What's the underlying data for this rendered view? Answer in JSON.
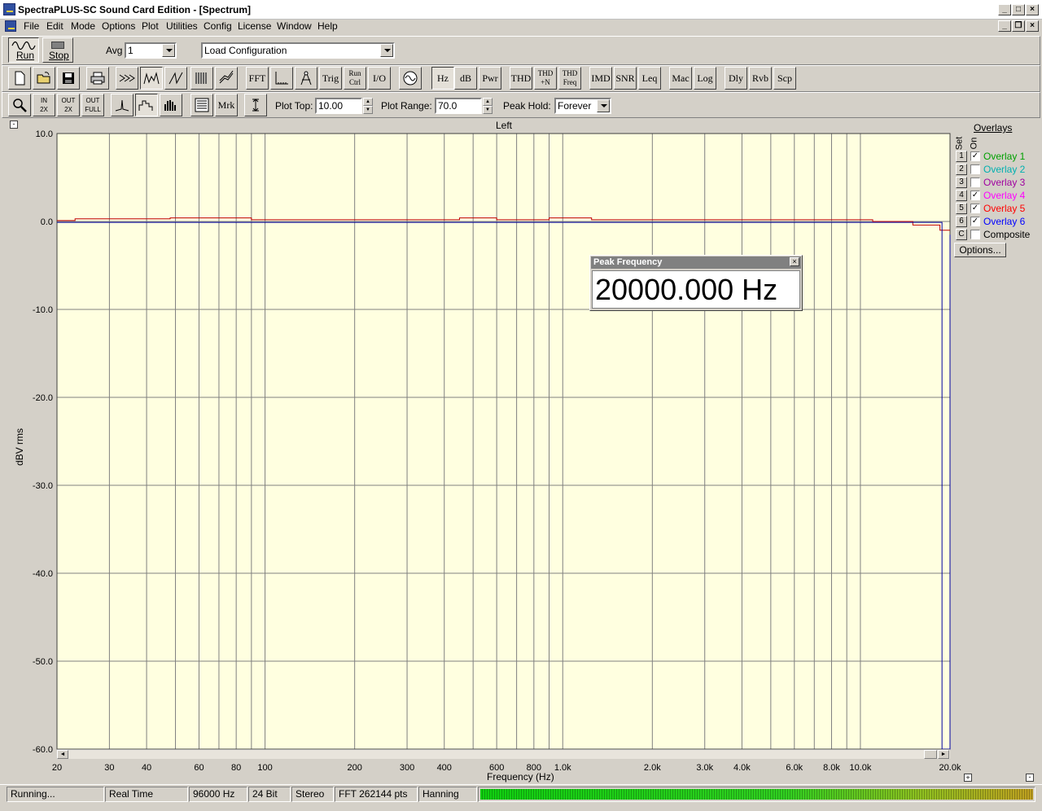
{
  "window": {
    "title": "SpectraPLUS-SC Sound Card Edition - [Spectrum]"
  },
  "menu": [
    "File",
    "Edit",
    "Mode",
    "Options",
    "Plot",
    "Utilities",
    "Config",
    "License",
    "Window",
    "Help"
  ],
  "toolbar1": {
    "run_label": "Run",
    "stop_label": "Stop",
    "avg_label": "Avg",
    "avg_value": "1",
    "config_value": "Load Configuration"
  },
  "toolbar2": {
    "fft": "FFT",
    "trig": "Trig",
    "run_ctrl_1": "Run",
    "run_ctrl_2": "Ctrl",
    "io": "I/O",
    "hz": "Hz",
    "db": "dB",
    "pwr": "Pwr",
    "thd": "THD",
    "thdn_1": "THD",
    "thdn_2": "+N",
    "thdf_1": "THD",
    "thdf_2": "Freq",
    "imd": "IMD",
    "snr": "SNR",
    "leq": "Leq",
    "mac": "Mac",
    "log": "Log",
    "dly": "Dly",
    "rvb": "Rvb",
    "scp": "Scp"
  },
  "toolbar3": {
    "zin_1": "IN",
    "zin_2": "2X",
    "zout_1": "OUT",
    "zout_2": "2X",
    "zfull_1": "OUT",
    "zfull_2": "FULL",
    "mrk": "Mrk",
    "plot_top_label": "Plot Top:",
    "plot_top_value": "10.00",
    "plot_range_label": "Plot Range:",
    "plot_range_value": "70.0",
    "peak_hold_label": "Peak Hold:",
    "peak_hold_value": "Forever"
  },
  "plot": {
    "channel_title": "Left",
    "ylabel": "dBV rms",
    "xlabel": "Frequency (Hz)",
    "y_ticks": [
      "10.0",
      "0.0",
      "-10.0",
      "-20.0",
      "-30.0",
      "-40.0",
      "-50.0",
      "-60.0"
    ],
    "x_ticks": [
      "20",
      "30",
      "40",
      "60",
      "80",
      "100",
      "200",
      "300",
      "400",
      "600",
      "800",
      "1.0k",
      "2.0k",
      "3.0k",
      "4.0k",
      "6.0k",
      "8.0k",
      "10.0k",
      "20.0k"
    ]
  },
  "overlays": {
    "title": "Overlays",
    "set_label": "Set",
    "on_label": "On",
    "items": [
      {
        "key": "1",
        "label": "Overlay 1",
        "checked": true,
        "color": "#00a000"
      },
      {
        "key": "2",
        "label": "Overlay 2",
        "checked": false,
        "color": "#00b0b0"
      },
      {
        "key": "3",
        "label": "Overlay 3",
        "checked": false,
        "color": "#a000a0"
      },
      {
        "key": "4",
        "label": "Overlay 4",
        "checked": true,
        "color": "#ff00ff"
      },
      {
        "key": "5",
        "label": "Overlay 5",
        "checked": true,
        "color": "#ff0000"
      },
      {
        "key": "6",
        "label": "Overlay 6",
        "checked": true,
        "color": "#0000ff"
      },
      {
        "key": "C",
        "label": "Composite",
        "checked": false,
        "color": "#000000"
      }
    ],
    "options_label": "Options..."
  },
  "peak_window": {
    "title": "Peak Frequency",
    "value": "20000.000 Hz"
  },
  "status": {
    "state": "Running...",
    "mode": "Real Time",
    "rate": "96000 Hz",
    "bits": "24 Bit",
    "channels": "Stereo",
    "fft": "FFT 262144 pts",
    "window": "Hanning"
  },
  "chart_data": {
    "type": "line",
    "title": "Left",
    "xlabel": "Frequency (Hz)",
    "ylabel": "dBV rms",
    "xscale": "log",
    "xlim": [
      20,
      20000
    ],
    "ylim": [
      -60,
      10
    ],
    "grid": true,
    "series": [
      {
        "color": "#c00000",
        "x": [
          20,
          23,
          48,
          90,
          450,
          600,
          900,
          1250,
          7000,
          11000,
          15000,
          18500,
          20000
        ],
        "y": [
          0.1,
          0.3,
          0.4,
          0.2,
          0.4,
          0.2,
          0.4,
          0.2,
          0.2,
          0.0,
          -0.4,
          -1.0,
          -1.0
        ]
      },
      {
        "color": "#0000a0",
        "x": [
          20,
          11000,
          18500,
          18800,
          20000
        ],
        "y": [
          -0.1,
          -0.1,
          -0.1,
          -60,
          -1.5
        ]
      }
    ]
  }
}
